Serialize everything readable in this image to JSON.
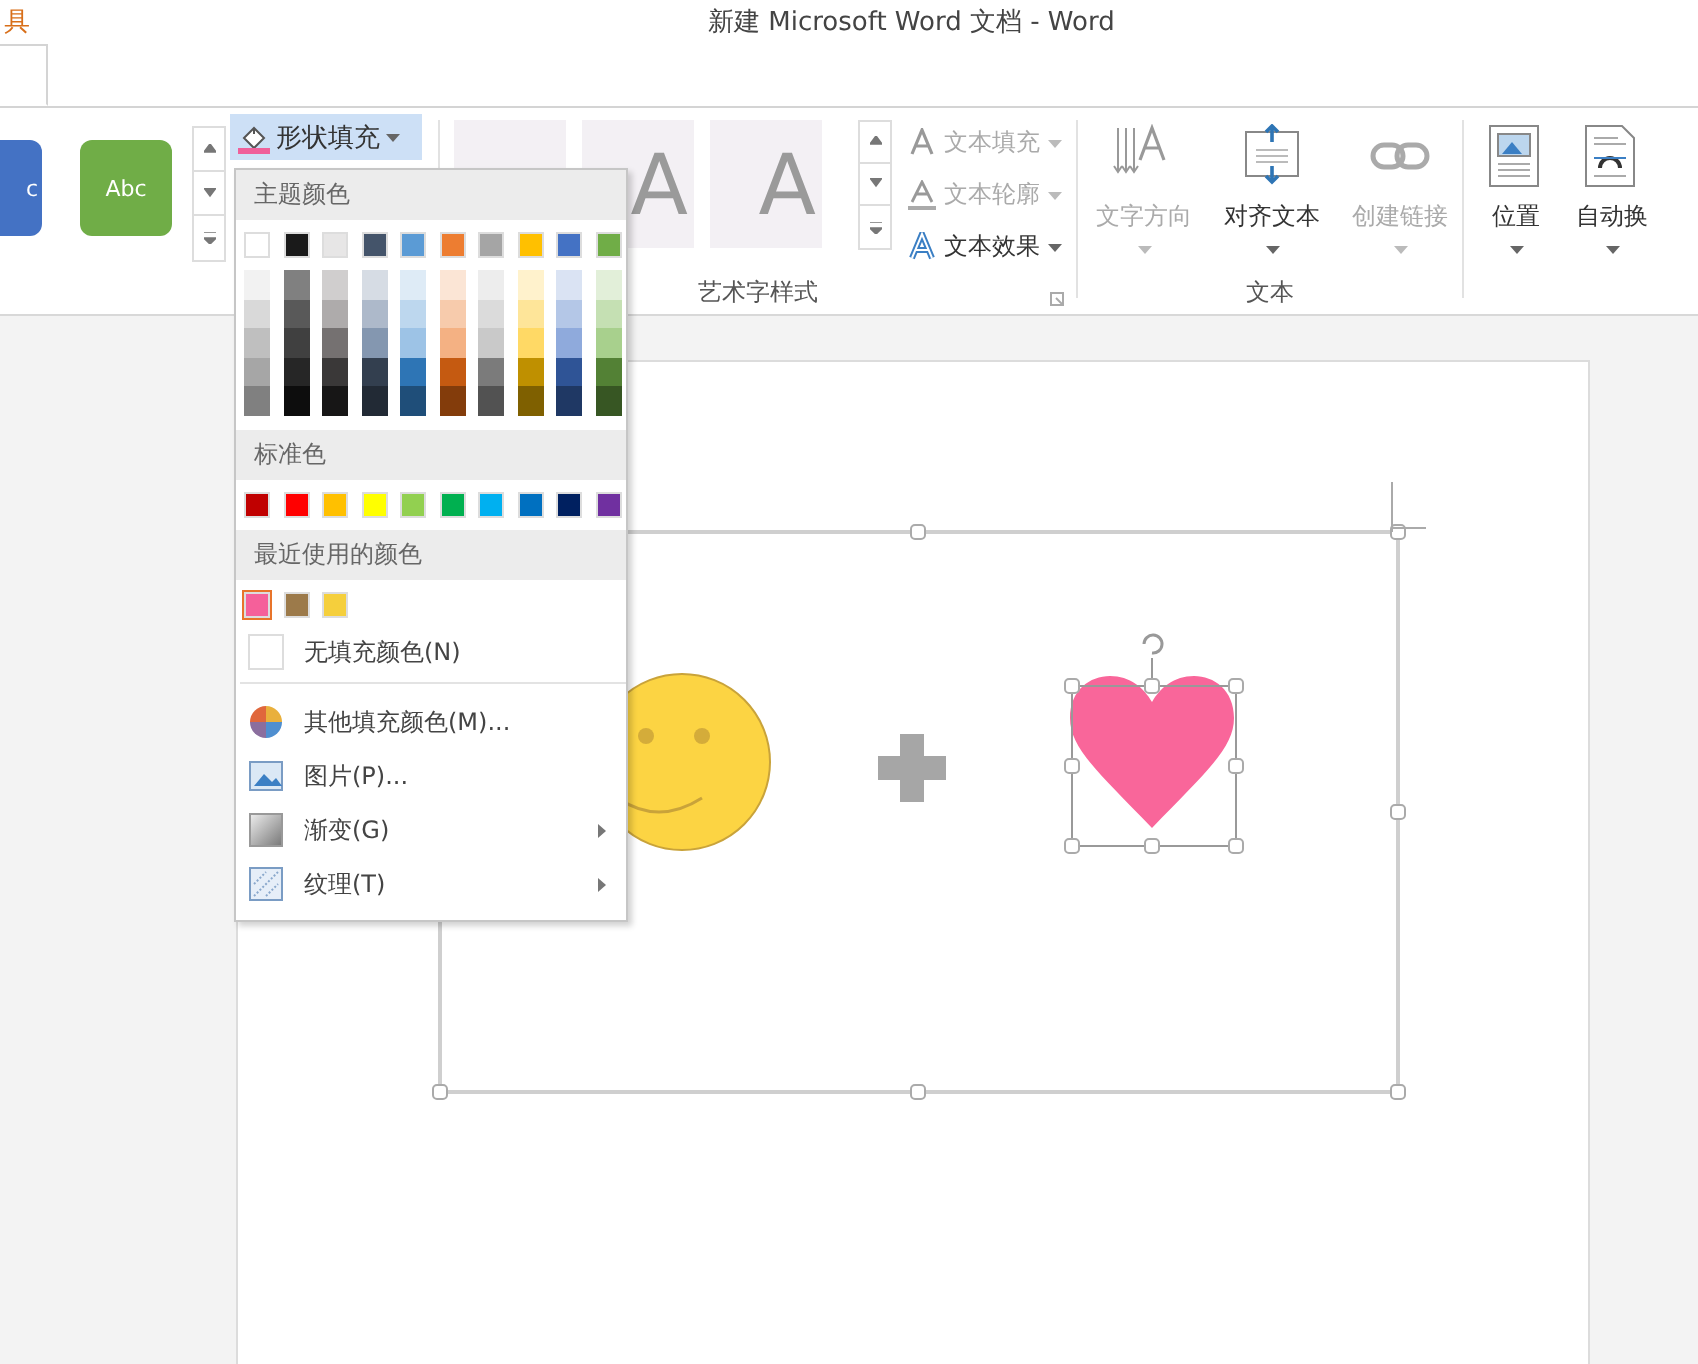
{
  "window": {
    "context_tab": "具",
    "title": "新建 Microsoft Word 文档 - Word"
  },
  "ribbon": {
    "shape_styles": [
      {
        "label": "c",
        "color": "#4472c4"
      },
      {
        "label": "Abc",
        "color": "#70ad47"
      }
    ],
    "shape_fill": {
      "label": "形状填充",
      "selected": true
    },
    "wordart": {
      "label": "艺术字样式",
      "styles": [
        {
          "label": "A"
        },
        {
          "label": "A"
        }
      ],
      "buttons": [
        {
          "kind": "fill",
          "label": "文本填充",
          "disabled": true
        },
        {
          "kind": "outline",
          "label": "文本轮廓",
          "disabled": true
        },
        {
          "kind": "effects",
          "label": "文本效果",
          "disabled": false
        }
      ]
    },
    "text": {
      "label": "文本",
      "buttons": [
        {
          "kind": "direction",
          "label": "文字方向",
          "disabled": true
        },
        {
          "kind": "align",
          "label": "对齐文本",
          "disabled": false
        },
        {
          "kind": "link",
          "label": "创建链接",
          "disabled": true
        }
      ]
    },
    "arrange": [
      {
        "kind": "position",
        "label": "位置"
      },
      {
        "kind": "wrap",
        "label": "自动换"
      }
    ]
  },
  "fill_menu": {
    "theme_header": "主题颜色",
    "theme_colors": [
      {
        "color": "#ffffff",
        "shades": [
          {
            "color": "#f2f2f2"
          },
          {
            "color": "#d9d9d9"
          },
          {
            "color": "#bfbfbf"
          },
          {
            "color": "#a6a6a6"
          },
          {
            "color": "#808080"
          }
        ]
      },
      {
        "color": "#1a1a1a",
        "shades": [
          {
            "color": "#808080"
          },
          {
            "color": "#595959"
          },
          {
            "color": "#404040"
          },
          {
            "color": "#262626"
          },
          {
            "color": "#0d0d0d"
          }
        ]
      },
      {
        "color": "#e7e6e6",
        "shades": [
          {
            "color": "#d0cece"
          },
          {
            "color": "#aeabab"
          },
          {
            "color": "#757171"
          },
          {
            "color": "#3a3838"
          },
          {
            "color": "#171616"
          }
        ]
      },
      {
        "color": "#44546a",
        "shades": [
          {
            "color": "#d6dce4"
          },
          {
            "color": "#adb9ca"
          },
          {
            "color": "#8497b0"
          },
          {
            "color": "#333f4f"
          },
          {
            "color": "#222a35"
          }
        ]
      },
      {
        "color": "#5b9bd5",
        "shades": [
          {
            "color": "#deebf6"
          },
          {
            "color": "#bdd7ee"
          },
          {
            "color": "#9dc3e6"
          },
          {
            "color": "#2e75b5"
          },
          {
            "color": "#1f4e79"
          }
        ]
      },
      {
        "color": "#ed7d31",
        "shades": [
          {
            "color": "#fbe5d5"
          },
          {
            "color": "#f7cbac"
          },
          {
            "color": "#f4b183"
          },
          {
            "color": "#c55a11"
          },
          {
            "color": "#833c0b"
          }
        ]
      },
      {
        "color": "#a5a5a5",
        "shades": [
          {
            "color": "#ededed"
          },
          {
            "color": "#dbdbdb"
          },
          {
            "color": "#c9c9c9"
          },
          {
            "color": "#7b7b7b"
          },
          {
            "color": "#525252"
          }
        ]
      },
      {
        "color": "#ffc000",
        "shades": [
          {
            "color": "#fff2cc"
          },
          {
            "color": "#fee599"
          },
          {
            "color": "#ffd965"
          },
          {
            "color": "#bf9000"
          },
          {
            "color": "#7f6000"
          }
        ]
      },
      {
        "color": "#4472c4",
        "shades": [
          {
            "color": "#dae3f3"
          },
          {
            "color": "#b4c7e7"
          },
          {
            "color": "#8faadc"
          },
          {
            "color": "#2f5496"
          },
          {
            "color": "#1f3864"
          }
        ]
      },
      {
        "color": "#70ad47",
        "shades": [
          {
            "color": "#e2efd9"
          },
          {
            "color": "#c5e0b3"
          },
          {
            "color": "#a8d08d"
          },
          {
            "color": "#538135"
          },
          {
            "color": "#375623"
          }
        ]
      }
    ],
    "standard_header": "标准色",
    "standard_colors": [
      {
        "color": "#c00000"
      },
      {
        "color": "#ff0000"
      },
      {
        "color": "#ffc000"
      },
      {
        "color": "#ffff00"
      },
      {
        "color": "#92d050"
      },
      {
        "color": "#00b050"
      },
      {
        "color": "#00b0f0"
      },
      {
        "color": "#0070c0"
      },
      {
        "color": "#002060"
      },
      {
        "color": "#7030a0"
      }
    ],
    "recent_header": "最近使用的颜色",
    "recent_colors": [
      {
        "color": "#f5609a",
        "selected": true
      },
      {
        "color": "#9c7a4a",
        "selected": false
      },
      {
        "color": "#f5cf3c",
        "selected": false
      }
    ],
    "items": [
      {
        "kind": "none",
        "label": "无填充颜色(N)",
        "submenu": false
      },
      {
        "kind": "more",
        "label": "其他填充颜色(M)...",
        "submenu": false
      },
      {
        "kind": "picture",
        "label": "图片(P)...",
        "submenu": false
      },
      {
        "kind": "gradient",
        "label": "渐变(G)",
        "submenu": true
      },
      {
        "kind": "texture",
        "label": "纹理(T)",
        "submenu": true
      }
    ]
  },
  "canvas": {
    "heart_selected": true
  }
}
